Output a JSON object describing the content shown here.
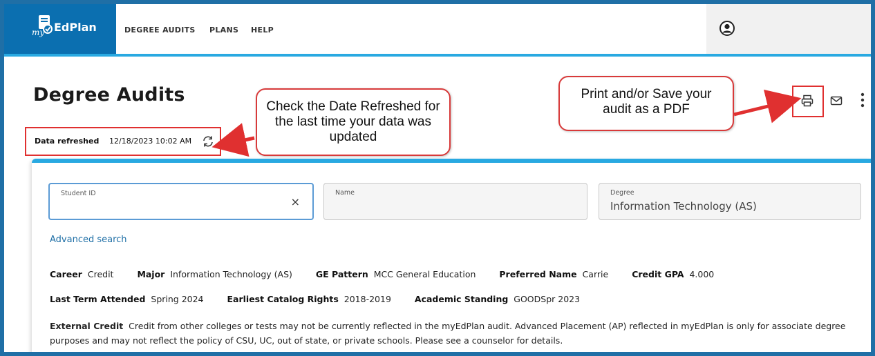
{
  "header": {
    "logo_my": "my",
    "logo_text": "EdPlan",
    "nav": [
      "DEGREE AUDITS",
      "PLANS",
      "HELP"
    ]
  },
  "page": {
    "title": "Degree Audits",
    "refresh_label": "Data refreshed",
    "refresh_value": "12/18/2023 10:02 AM"
  },
  "callouts": {
    "date": "Check the Date Refreshed for the last time your data was updated",
    "print": "Print and/or Save your audit as a PDF"
  },
  "form": {
    "student_id_label": "Student ID",
    "student_id_value": "",
    "name_label": "Name",
    "name_value": "",
    "degree_label": "Degree",
    "degree_value": "Information Technology (AS)",
    "clear_symbol": "×",
    "advanced_search": "Advanced search"
  },
  "info": {
    "career_label": "Career",
    "career_value": "Credit",
    "major_label": "Major",
    "major_value": "Information Technology (AS)",
    "ge_label": "GE Pattern",
    "ge_value": "MCC General Education",
    "preferred_label": "Preferred Name",
    "preferred_value": "Carrie",
    "gpa_label": "Credit GPA",
    "gpa_value": "4.000",
    "last_term_label": "Last Term Attended",
    "last_term_value": "Spring 2024",
    "catalog_label": "Earliest Catalog Rights",
    "catalog_value": "2018-2019",
    "standing_label": "Academic Standing",
    "standing_value": "GOODSpr 2023",
    "external_label": "External Credit",
    "external_value": "Credit from other colleges or tests may not be currently reflected in the myEdPlan audit. Advanced Placement (AP) reflected in myEdPlan is only for associate degree purposes and may not reflect the policy of CSU, UC, out of state, or private schools. Please see a counselor for details."
  },
  "colors": {
    "brand": "#0b6fb0",
    "accent": "#29a9e1",
    "frame": "#1f6fa6",
    "annotation": "#e03030"
  }
}
